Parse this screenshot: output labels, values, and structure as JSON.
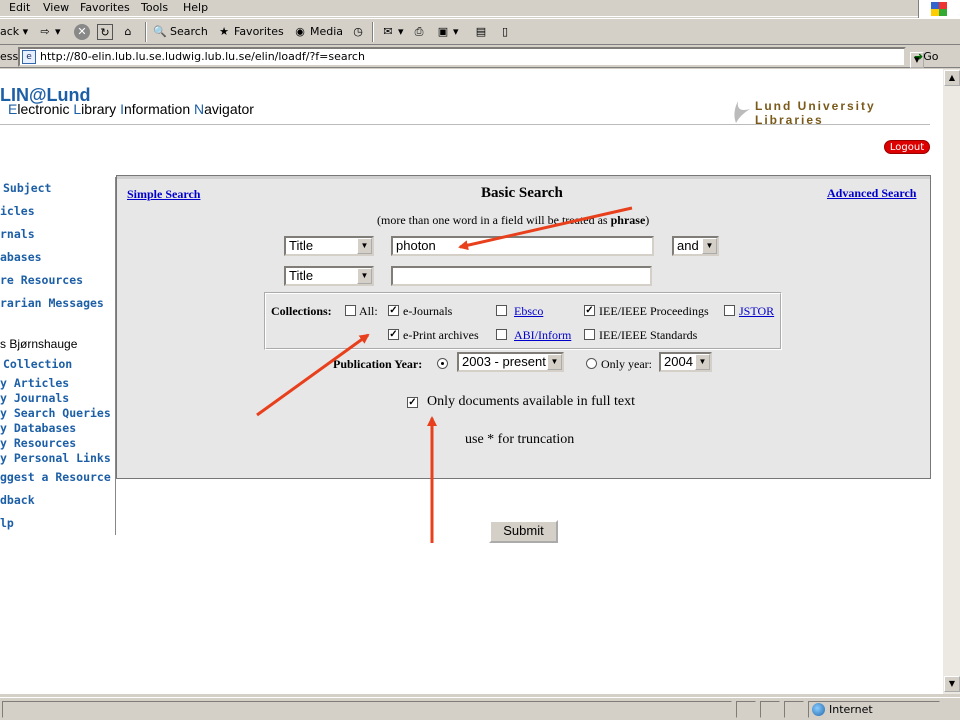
{
  "browser": {
    "menu": [
      "Edit",
      "View",
      "Favorites",
      "Tools",
      "Help"
    ],
    "toolbar": {
      "back": "ack",
      "search": "Search",
      "favorites": "Favorites",
      "media": "Media"
    },
    "address": {
      "label": "ess",
      "url": "http://80-elin.lub.lu.se.ludwig.lub.lu.se/elin/loadf/?f=search",
      "go": "Go"
    },
    "status": {
      "zone": "Internet"
    }
  },
  "header": {
    "app_title": "LIN@Lund",
    "subtitle_parts": [
      "E",
      "lectronic ",
      "L",
      "ibrary ",
      "I",
      "nformation ",
      "N",
      "avigator"
    ],
    "library": "Lund University Libraries",
    "logout": "Logout"
  },
  "nav": {
    "items": [
      "Subject",
      "icles",
      "rnals",
      "abases",
      "re Resources",
      "rarian Messages"
    ],
    "user": "s Bjørnshauge",
    "my_items": [
      "Collection",
      "y Articles",
      "y Journals",
      "y Search Queries",
      "y Databases",
      "y Resources",
      "y Personal Links",
      "ggest a Resource"
    ],
    "bottom": [
      "dback",
      "lp"
    ]
  },
  "search": {
    "simple_link": "Simple Search",
    "title": "Basic Search",
    "advanced_link": "Advanced Search",
    "hint_prefix": "(more than one word in a field will be treated as ",
    "hint_bold": "phrase",
    "hint_suffix": ")",
    "row1": {
      "field": "Title",
      "value": "photon",
      "operator": "and"
    },
    "row2": {
      "field": "Title",
      "value": ""
    },
    "collections_label": "Collections:",
    "collections": [
      {
        "label": "All:",
        "checked": false,
        "link": false
      },
      {
        "label": "e-Journals",
        "checked": true,
        "link": false
      },
      {
        "label": "Ebsco",
        "checked": false,
        "link": true
      },
      {
        "label": "IEE/IEEE Proceedings",
        "checked": true,
        "link": false
      },
      {
        "label": "JSTOR",
        "checked": false,
        "link": true
      },
      {
        "label": "e-Print archives",
        "checked": true,
        "link": false
      },
      {
        "label": "ABI/Inform",
        "checked": false,
        "link": true
      },
      {
        "label": "IEE/IEEE Standards",
        "checked": false,
        "link": false
      }
    ],
    "pub_year_label": "Publication Year:",
    "pub_year_range": "2003 - present",
    "only_year_label": "Only year:",
    "only_year_value": "2004",
    "fulltext_label": "Only documents available in full text",
    "fulltext_checked": true,
    "truncation_hint": "use * for truncation",
    "submit": "Submit"
  },
  "colors": {
    "link": "#0000cc",
    "brand": "#1d5fa6",
    "arrow": "#e8401c",
    "logout": "#dd0000"
  }
}
